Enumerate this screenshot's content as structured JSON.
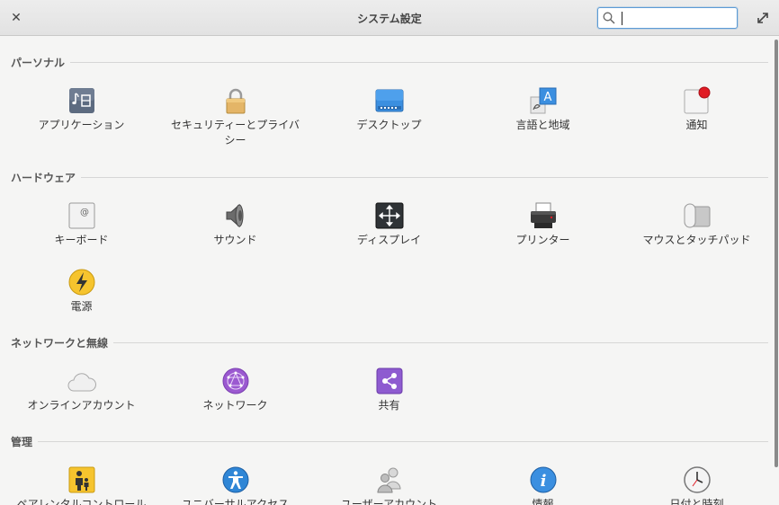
{
  "window": {
    "title": "システム設定",
    "search_placeholder": "",
    "search_value": ""
  },
  "sections": {
    "personal": {
      "header": "パーソナル",
      "items": [
        {
          "label": "アプリケーション",
          "icon": "applications-icon"
        },
        {
          "label": "セキュリティーとプライバシー",
          "icon": "lock-icon"
        },
        {
          "label": "デスクトップ",
          "icon": "desktop-icon"
        },
        {
          "label": "言語と地域",
          "icon": "language-icon"
        },
        {
          "label": "通知",
          "icon": "notifications-icon"
        }
      ]
    },
    "hardware": {
      "header": "ハードウェア",
      "items": [
        {
          "label": "キーボード",
          "icon": "keyboard-icon"
        },
        {
          "label": "サウンド",
          "icon": "speaker-icon"
        },
        {
          "label": "ディスプレイ",
          "icon": "display-icon"
        },
        {
          "label": "プリンター",
          "icon": "printer-icon"
        },
        {
          "label": "マウスとタッチパッド",
          "icon": "mouse-icon"
        },
        {
          "label": "電源",
          "icon": "power-icon"
        }
      ]
    },
    "network": {
      "header": "ネットワークと無線",
      "items": [
        {
          "label": "オンラインアカウント",
          "icon": "cloud-icon"
        },
        {
          "label": "ネットワーク",
          "icon": "network-icon"
        },
        {
          "label": "共有",
          "icon": "share-icon"
        }
      ]
    },
    "admin": {
      "header": "管理",
      "items": [
        {
          "label": "ペアレンタルコントロール",
          "icon": "parental-control-icon"
        },
        {
          "label": "ユニバーサルアクセス",
          "icon": "accessibility-icon"
        },
        {
          "label": "ユーザーアカウント",
          "icon": "users-icon"
        },
        {
          "label": "情報",
          "icon": "info-icon"
        },
        {
          "label": "日付と時刻",
          "icon": "clock-icon"
        }
      ]
    }
  },
  "colors": {
    "accent": "#5c9bd5",
    "notification_dot": "#e01b24",
    "power": "#f6c42e",
    "network": "#9b59d0",
    "share": "#8e5bd0",
    "accessibility": "#2f86d6"
  }
}
